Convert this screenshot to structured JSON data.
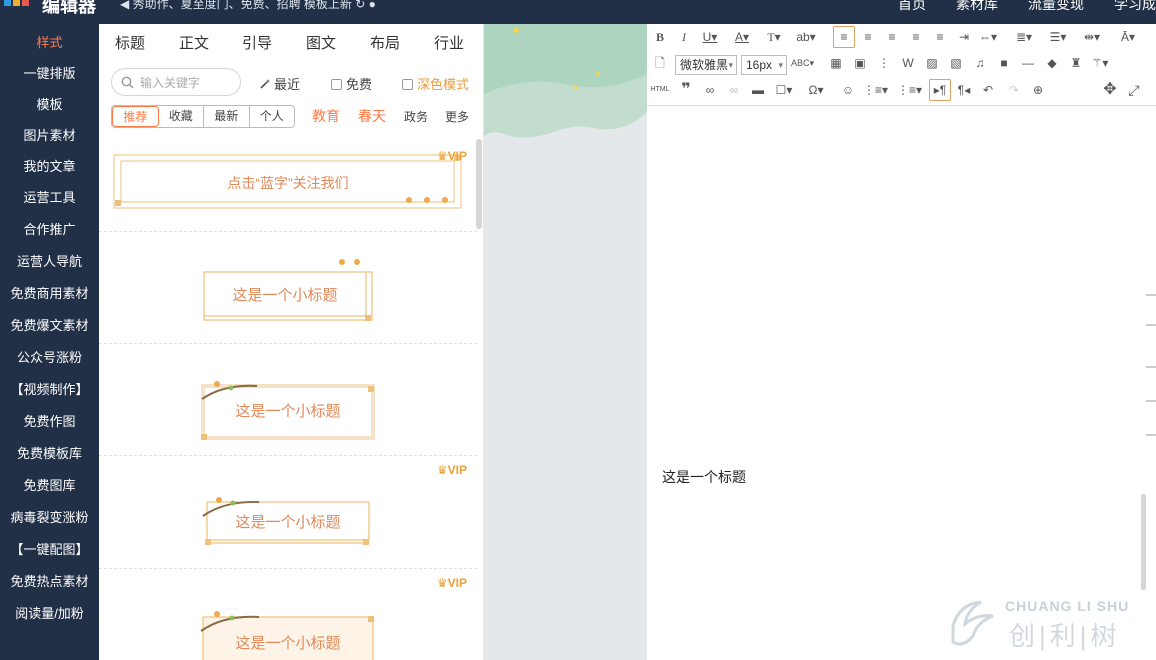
{
  "header": {
    "logo_text": "编辑器",
    "announcement": "◀ 秀助作、夏至度门、免费、招聘 模板上新 ↻ ●",
    "nav": [
      "首页",
      "素材库",
      "流量变现",
      "学习成"
    ]
  },
  "sidebar": {
    "items": [
      {
        "label": "样式",
        "active": true
      },
      {
        "label": "一键排版"
      },
      {
        "label": "模板"
      },
      {
        "label": "图片素材"
      },
      {
        "label": "我的文章"
      },
      {
        "label": "运营工具"
      },
      {
        "label": "合作推广"
      },
      {
        "label": "运营人导航"
      },
      {
        "label": "免费商用素材"
      },
      {
        "label": "免费爆文素材"
      },
      {
        "label": "公众号涨粉"
      },
      {
        "label": "【视频制作】"
      },
      {
        "label": "免费作图"
      },
      {
        "label": "免费模板库"
      },
      {
        "label": "免费图库"
      },
      {
        "label": "病毒裂变涨粉"
      },
      {
        "label": "【一键配图】"
      },
      {
        "label": "免费热点素材"
      },
      {
        "label": "阅读量/加粉"
      }
    ]
  },
  "panel": {
    "category_tabs": [
      "标题",
      "正文",
      "引导",
      "图文",
      "布局",
      "行业"
    ],
    "search_placeholder": "输入关键字",
    "recent_label": "最近",
    "free_label": "免费",
    "dark_mode_label": "深色模式",
    "segments": [
      "推荐",
      "收藏",
      "最新",
      "个人"
    ],
    "hot_filters": [
      "教育",
      "春天"
    ],
    "filters": [
      "政务",
      "更多"
    ],
    "templates": [
      {
        "text": "点击“蓝字”关注我们",
        "vip": "VIP"
      },
      {
        "text": "这是一个小标题",
        "vip": ""
      },
      {
        "text": "这是一个小标题",
        "vip": ""
      },
      {
        "text": "这是一个小标题",
        "vip": "VIP"
      },
      {
        "text": "这是一个小标题",
        "vip": "VIP"
      }
    ]
  },
  "editor": {
    "font_family": "微软雅黑",
    "font_size": "16px",
    "html_label": "HTML",
    "body_text": "这是一个标题"
  },
  "watermark": {
    "latin": "CHUANG LI SHU",
    "cjk": "创|利|树"
  },
  "colors": {
    "nav_bg": "#223047",
    "accent": "#ff7a45",
    "vip": "#e9a23b",
    "template_text": "#e08a5a"
  }
}
